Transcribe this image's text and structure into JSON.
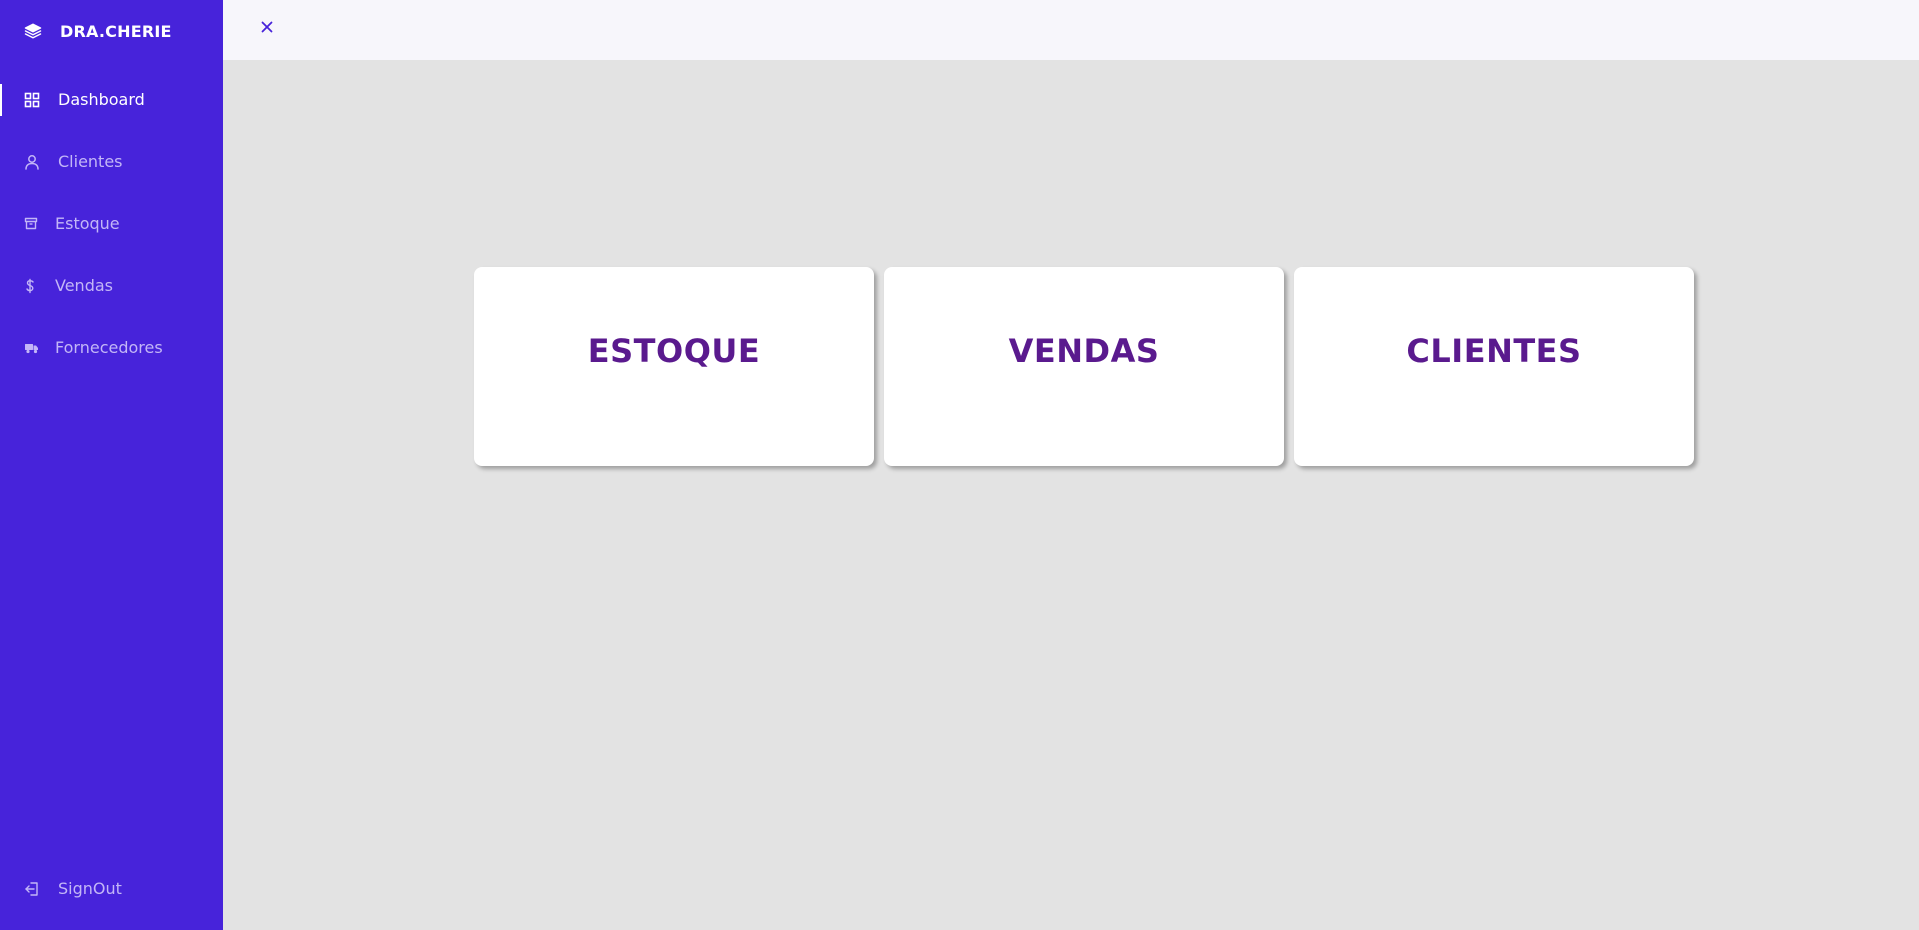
{
  "brand": {
    "name": "DRA.CHERIE",
    "icon": "layers-icon"
  },
  "sidebar": {
    "items": [
      {
        "label": "Dashboard",
        "icon": "grid-icon",
        "active": true
      },
      {
        "label": "Clientes",
        "icon": "user-icon",
        "active": false
      },
      {
        "label": "Estoque",
        "icon": "archive-icon",
        "active": false
      },
      {
        "label": "Vendas",
        "icon": "dollar-icon",
        "active": false
      },
      {
        "label": "Fornecedores",
        "icon": "truck-icon",
        "active": false
      }
    ],
    "signout": {
      "label": "SignOut",
      "icon": "logout-icon"
    }
  },
  "topbar": {
    "close_icon": "close-icon"
  },
  "cards": [
    {
      "title": "ESTOQUE"
    },
    {
      "title": "VENDAS"
    },
    {
      "title": "CLIENTES"
    }
  ],
  "colors": {
    "sidebar_bg": "#4723da",
    "card_title": "#5a1a8e",
    "main_bg": "#e3e3e3",
    "topbar_bg": "#f7f6fb"
  }
}
